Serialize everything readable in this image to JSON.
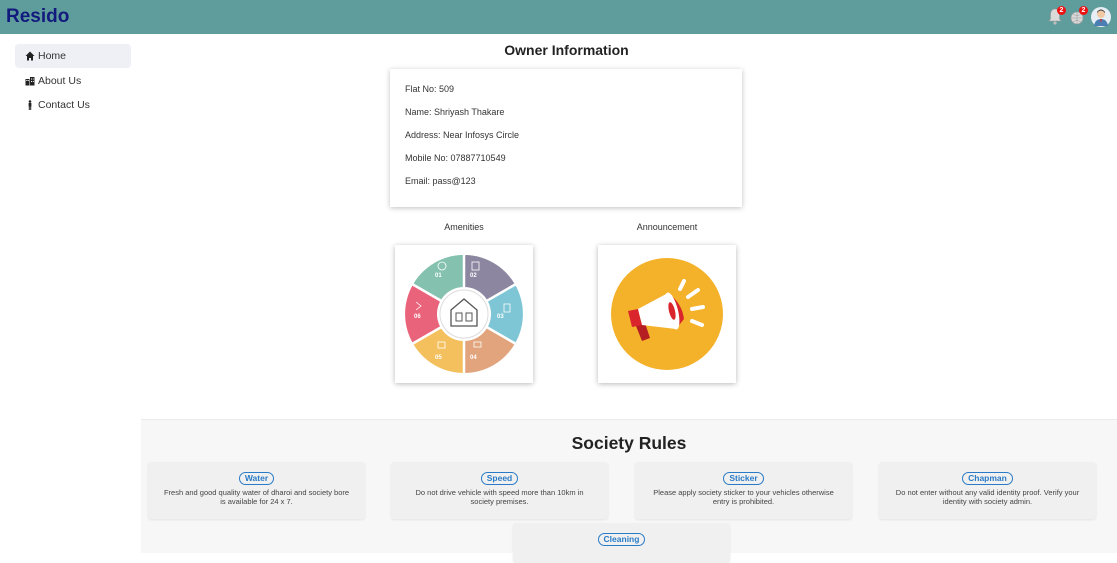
{
  "header": {
    "brand": "Resido",
    "notification_count_1": "2",
    "notification_count_2": "2"
  },
  "sidebar": {
    "items": [
      {
        "label": "Home",
        "icon": "home-icon"
      },
      {
        "label": "About Us",
        "icon": "building-icon"
      },
      {
        "label": "Contact Us",
        "icon": "person-icon"
      }
    ]
  },
  "owner": {
    "title": "Owner Information",
    "flat": "Flat No: 509",
    "name": "Name: Shriyash Thakare",
    "address": "Address: Near Infosys Circle",
    "mobile": "Mobile No: 07887710549",
    "email": "Email: pass@123"
  },
  "cards": {
    "amenities": "Amenities",
    "announcement": "Announcement"
  },
  "amenities_wheel": [
    "01",
    "02",
    "03",
    "04",
    "05",
    "06"
  ],
  "rules": {
    "title": "Society Rules",
    "items": [
      {
        "name": "Water",
        "text": "Fresh and good quality water of dharoi and society bore is available for 24 x 7."
      },
      {
        "name": "Speed",
        "text": "Do not drive vehicle with speed more than 10km in society premises."
      },
      {
        "name": "Sticker",
        "text": "Please apply society sticker to your vehicles otherwise entry is prohibited."
      },
      {
        "name": "Chapman",
        "text": "Do not enter without any valid identity proof. Verify your identity with society admin."
      },
      {
        "name": "Cleaning",
        "text": ""
      }
    ]
  },
  "colors": {
    "topbar": "#5f9d9c",
    "brand": "#131a7d",
    "accent": "#2a7bc7",
    "announcement_bg": "#f4b12a"
  }
}
